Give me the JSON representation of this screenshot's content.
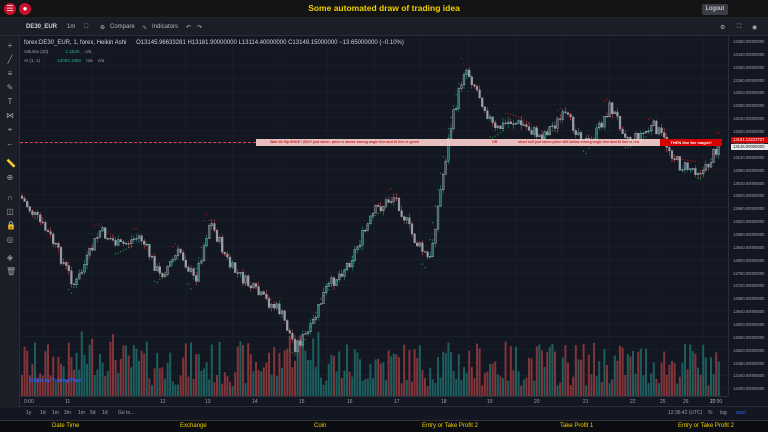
{
  "app": {
    "title": "Some automated draw of trading idea",
    "logout_label": "Logout"
  },
  "toolbar": {
    "symbol": "DE30_EUR",
    "interval": "1m",
    "compare_label": "Compare",
    "indicators_label": "Indicators"
  },
  "legend": {
    "symbol_line": "forex:DE30_EUR, 1, forex, Heikin Ashi",
    "ohlc": "O13145.96633281  H13181.90000000  L13114.40000000  C13149.15000000  −13.65000000 (−0.10%)",
    "volume_label": "Volume (20)",
    "volume_value": "1.483K",
    "volume_na": "n/a",
    "ai_label": "AI (1, 1)",
    "ai_value": "13093.1980",
    "ai_na1": "n/a",
    "ai_na2": "n/a"
  },
  "price_axis": {
    "labels": [
      "13480.00000000",
      "13440.00000000",
      "13400.00000000",
      "13360.00000000",
      "13320.00000000",
      "13280.00000000",
      "13240.00000000",
      "13200.00000000",
      "13160.00000000",
      "13120.00000000",
      "13080.00000000",
      "13040.00000000",
      "13000.00000000",
      "12960.00000000",
      "12920.00000000",
      "12880.00000000",
      "12840.00000000",
      "12800.00000000",
      "12760.00000000",
      "12720.00000000",
      "12680.00000000",
      "12640.00000000",
      "12600.00000000",
      "12560.00000000",
      "12520.00000000",
      "12480.00000000",
      "12440.00000000",
      "12400.00000000"
    ],
    "tag_red": "13161.13223707",
    "tag_white": "13146.00000000"
  },
  "time_axis": {
    "labels": [
      "0:00",
      "11",
      "12",
      "13",
      "14",
      "15",
      "16",
      "17",
      "18",
      "19",
      "20",
      "21",
      "22",
      "25",
      "26",
      "27",
      "11:00"
    ]
  },
  "annotation": {
    "text1": "Wait till flip ENDS  !  (BUY just when:  price is above strong angle line and AI line is green",
    "text2": "OR",
    "text3": "short sell just when price still below strong angle line and AI line is red",
    "magic": "THEN line the magic!!"
  },
  "controls": {
    "ranges": [
      "1y",
      "1d",
      "1m",
      "3m",
      "1m",
      "5d",
      "1d"
    ],
    "goto": "Go to...",
    "time": "12:36:42 (UTC)",
    "pct": "%",
    "log": "log",
    "auto": "auto"
  },
  "footer": {
    "columns": [
      "Date Time",
      "Exchange",
      "Coin",
      "Entry or Take Profit 2",
      "Take Profit 1",
      "Entry or Take Profit 2"
    ]
  },
  "tv_logo": "Chart by TradingView",
  "colors": {
    "up": "#26a69a",
    "down": "#ef5350",
    "background": "#131722",
    "title": "#f0d000"
  }
}
